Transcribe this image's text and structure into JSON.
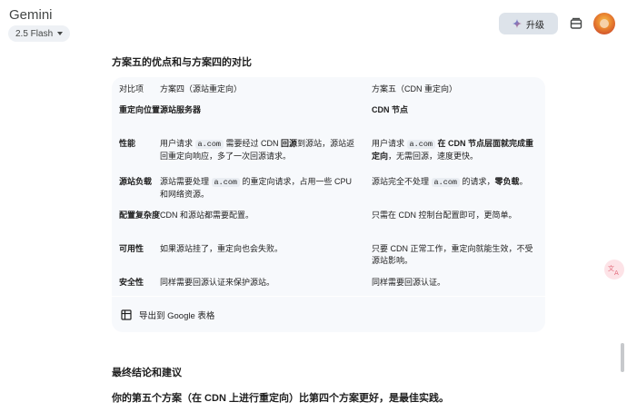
{
  "app": {
    "title": "Gemini",
    "model": "2.5 Flash"
  },
  "header": {
    "upgrade_label": "升级",
    "icons": [
      "sparkle-icon",
      "inbox-icon",
      "avatar"
    ]
  },
  "section": {
    "heading": "方案五的优点和与方案四的对比"
  },
  "table": {
    "headers": [
      "对比项",
      "方案四（源站重定向）",
      "方案五（CDN 重定向）"
    ],
    "rows": [
      {
        "item": "重定向位置",
        "plan4": "源站服务器",
        "plan5": "CDN 节点"
      },
      {
        "item": "性能",
        "plan4": {
          "p1": "用户请求 ",
          "code": "a.com",
          "p2": " 需要经过 CDN ",
          "b": "回源",
          "p3": "到源站，源站返回重定向响应，多了一次回源请求。"
        },
        "plan5": {
          "p1": "用户请求 ",
          "code": "a.com",
          "b": " 在 CDN 节点层面就完成重定向",
          "p2": "，无需回源，速度更快。"
        }
      },
      {
        "item": "源站负载",
        "plan4": {
          "p1": "源站需要处理 ",
          "code": "a.com",
          "p2": " 的重定向请求，占用一些 CPU 和网络资源。"
        },
        "plan5": {
          "p1": "源站完全不处理 ",
          "code": "a.com",
          "p2": " 的请求，",
          "b": "零负载",
          "p3": "。"
        }
      },
      {
        "item": "配置复杂度",
        "plan4": "CDN 和源站都需要配置。",
        "plan5": "只需在 CDN 控制台配置即可，更简单。"
      },
      {
        "item": "可用性",
        "plan4": "如果源站挂了，重定向也会失败。",
        "plan5": "只要 CDN 正常工作，重定向就能生效，不受源站影响。"
      },
      {
        "item": "安全性",
        "plan4": "同样需要回源认证来保护源站。",
        "plan5": "同样需要回源认证。"
      }
    ],
    "export_label": "导出到 Google 表格"
  },
  "conclusion": {
    "heading": "最终结论和建议",
    "text": "你的第五个方案（在 CDN 上进行重定向）比第四个方案更好，是最佳实践。"
  },
  "colors": {
    "accent": "#1a73e8",
    "card_bg": "#f7f9fc",
    "upgrade_bg": "#dde3ea"
  }
}
